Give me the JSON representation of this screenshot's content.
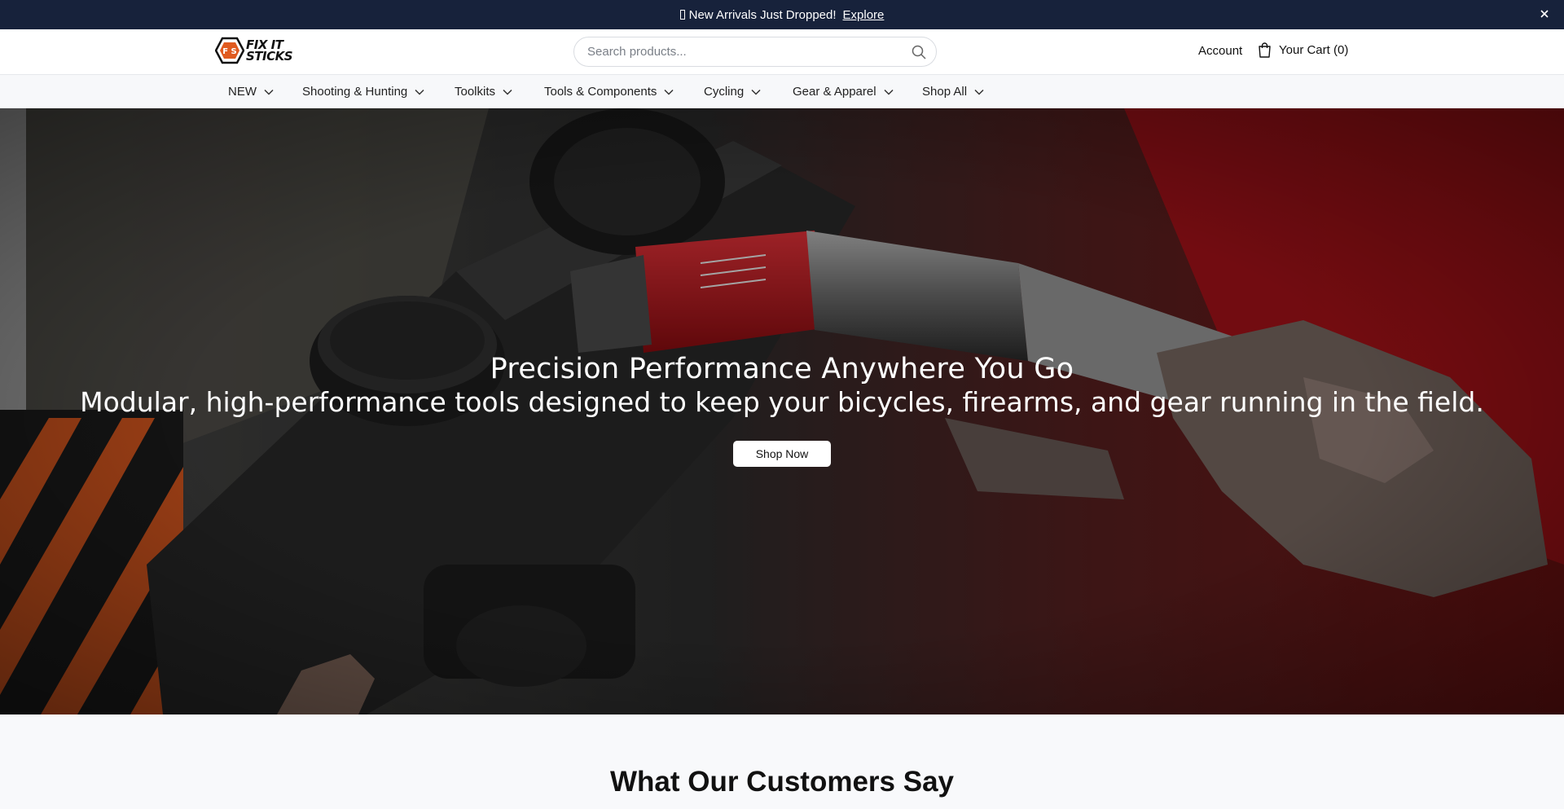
{
  "announcement": {
    "text": "New Arrivals Just Dropped!",
    "link_label": "Explore",
    "icon": "missing-glyph-icon"
  },
  "header": {
    "logo_alt": "FIX IT STICKS",
    "logo_line1": "FIX IT",
    "logo_line2": "STICKS",
    "search_placeholder": "Search products...",
    "account_label": "Account",
    "cart_label": "Your Cart (0)"
  },
  "nav": {
    "items": [
      {
        "label": "NEW"
      },
      {
        "label": "Shooting & Hunting"
      },
      {
        "label": "Toolkits"
      },
      {
        "label": "Tools & Components"
      },
      {
        "label": "Cycling"
      },
      {
        "label": "Gear & Apparel"
      },
      {
        "label": "Shop All"
      }
    ]
  },
  "hero": {
    "title": "Precision Performance Anywhere You Go",
    "subtitle": "Modular, high-performance tools designed to keep your bicycles, firearms, and gear running in the field.",
    "cta_label": "Shop Now"
  },
  "testimonials": {
    "heading": "What Our Customers Say"
  },
  "colors": {
    "announcement_bg": "#17223b",
    "brand_orange": "#e05a1f",
    "tool_red": "#d4141b"
  }
}
